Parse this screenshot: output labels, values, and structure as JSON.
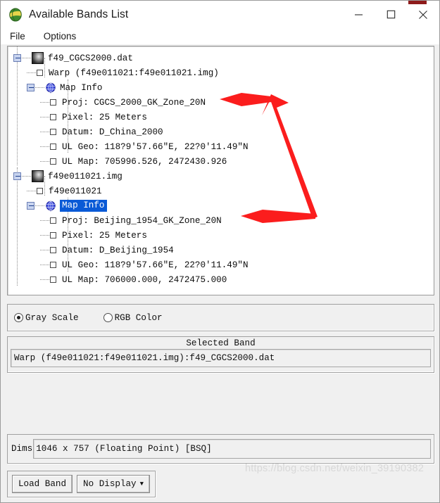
{
  "window": {
    "title": "Available Bands List",
    "app_icon": "envi-globe-icon",
    "controls": {
      "minimize": "minimize-icon",
      "maximize": "maximize-icon",
      "close": "close-icon"
    }
  },
  "menubar": {
    "items": [
      {
        "label": "File"
      },
      {
        "label": "Options"
      }
    ]
  },
  "tree": {
    "nodes": [
      {
        "id": "root1",
        "depth": 0,
        "icon": "file-thumbnail-icon",
        "expander": "minus",
        "label": "f49_CGCS2000.dat",
        "selected": false
      },
      {
        "id": "band1",
        "depth": 1,
        "icon": "checkbox",
        "label": "Warp (f49e011021:f49e011021.img)",
        "selected": false
      },
      {
        "id": "mapinfo1",
        "depth": 1,
        "icon": "globe-icon",
        "expander": "minus",
        "label": "Map Info",
        "selected": false
      },
      {
        "id": "proj1",
        "depth": 2,
        "icon": "checkbox",
        "label": "Proj: CGCS_2000_GK_Zone_20N",
        "selected": false
      },
      {
        "id": "pixel1",
        "depth": 2,
        "icon": "checkbox",
        "label": "Pixel: 25 Meters",
        "selected": false
      },
      {
        "id": "datum1",
        "depth": 2,
        "icon": "checkbox",
        "label": "Datum: D_China_2000",
        "selected": false
      },
      {
        "id": "ulgeo1",
        "depth": 2,
        "icon": "checkbox",
        "label": "UL Geo: 118?9'57.66\"E,  22?0'11.49\"N",
        "selected": false
      },
      {
        "id": "ulmap1",
        "depth": 2,
        "icon": "checkbox",
        "label": "UL Map: 705996.526,  2472430.926",
        "selected": false
      },
      {
        "id": "root2",
        "depth": 0,
        "icon": "file-thumbnail-icon",
        "expander": "minus",
        "label": "f49e011021.img",
        "selected": false
      },
      {
        "id": "band2",
        "depth": 1,
        "icon": "checkbox",
        "label": "f49e011021",
        "selected": false
      },
      {
        "id": "mapinfo2",
        "depth": 1,
        "icon": "globe-icon",
        "expander": "minus",
        "label": "Map Info",
        "selected": true
      },
      {
        "id": "proj2",
        "depth": 2,
        "icon": "checkbox",
        "label": "Proj: Beijing_1954_GK_Zone_20N",
        "selected": false
      },
      {
        "id": "pixel2",
        "depth": 2,
        "icon": "checkbox",
        "label": "Pixel: 25 Meters",
        "selected": false
      },
      {
        "id": "datum2",
        "depth": 2,
        "icon": "checkbox",
        "label": "Datum: D_Beijing_1954",
        "selected": false
      },
      {
        "id": "ulgeo2",
        "depth": 2,
        "icon": "checkbox",
        "label": "UL Geo: 118?9'57.66\"E,  22?0'11.49\"N",
        "selected": false
      },
      {
        "id": "ulmap2",
        "depth": 2,
        "icon": "checkbox",
        "label": "UL Map: 706000.000,  2472475.000",
        "selected": false
      }
    ],
    "selection_color": "#0a5ad6"
  },
  "color_mode": {
    "options": [
      {
        "label": "Gray Scale",
        "selected": true
      },
      {
        "label": "RGB Color",
        "selected": false
      }
    ]
  },
  "selected_band": {
    "title": "Selected Band",
    "value": "Warp (f49e011021:f49e011021.img):f49_CGCS2000.dat"
  },
  "dims": {
    "label": "Dims",
    "value": "1046 x 757 (Floating Point) [BSQ]"
  },
  "buttons": {
    "load_band": "Load Band",
    "display_select": "No Display",
    "display_caret": "▼"
  },
  "annotations": {
    "arrow_color": "#fb1d1d",
    "arrows": [
      "arrow-to-proj-cgcs2000",
      "arrow-to-proj-beijing1954",
      "arrow-diagonal-connector"
    ]
  },
  "watermark": {
    "text": "https://blog.csdn.net/weixin_39190382"
  }
}
